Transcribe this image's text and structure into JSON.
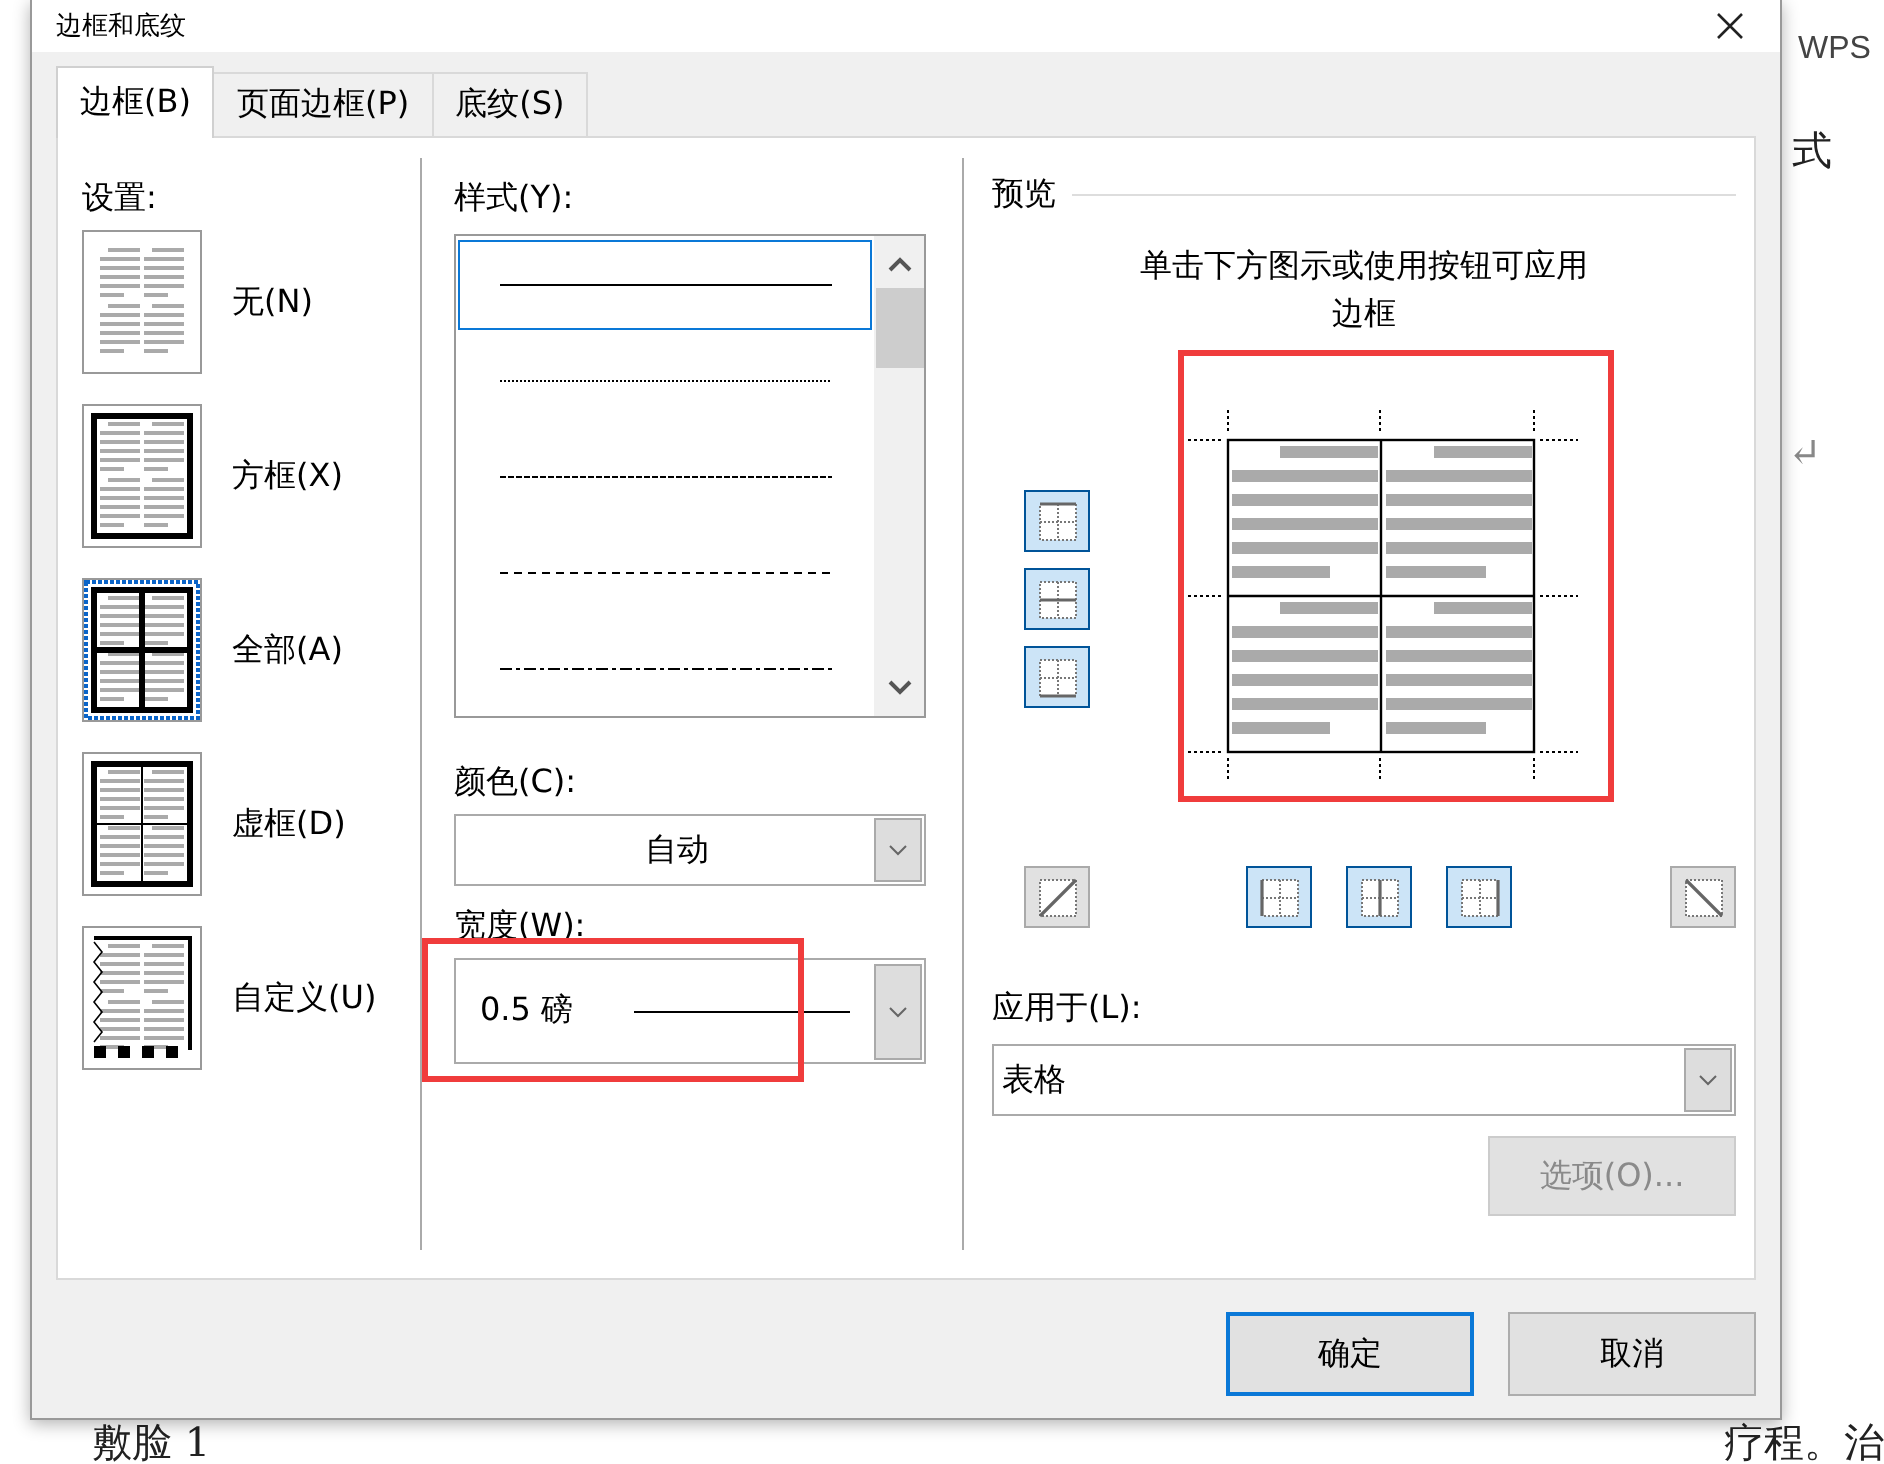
{
  "document": {
    "texts": [
      {
        "kind": "top-right",
        "text": "WPS"
      },
      {
        "kind": "right",
        "text": "式"
      },
      {
        "kind": "mark",
        "text": "↵"
      },
      {
        "kind": "bottom-left",
        "text": "敷脸 1"
      },
      {
        "kind": "bottom-right",
        "text": "疗程。治"
      }
    ]
  },
  "window": {
    "title": "边框和底纹"
  },
  "tabs": [
    {
      "label": "边框(B)",
      "selected": true
    },
    {
      "label": "页面边框(P)",
      "selected": false
    },
    {
      "label": "底纹(S)",
      "selected": false
    }
  ],
  "settings": {
    "label": "设置:",
    "items": [
      {
        "kind": "none",
        "label": "无(N)",
        "selected": false
      },
      {
        "kind": "box",
        "label": "方框(X)",
        "selected": false
      },
      {
        "kind": "all",
        "label": "全部(A)",
        "selected": true
      },
      {
        "kind": "grid",
        "label": "虚框(D)",
        "selected": false
      },
      {
        "kind": "custom",
        "label": "自定义(U)",
        "selected": false
      }
    ]
  },
  "style": {
    "label": "样式(Y):",
    "items": [
      {
        "kind": "solid",
        "selected": true
      },
      {
        "kind": "dotted",
        "selected": false
      },
      {
        "kind": "fine-dash",
        "selected": false
      },
      {
        "kind": "dash",
        "selected": false
      },
      {
        "kind": "dash-dot",
        "selected": false
      }
    ]
  },
  "color": {
    "label": "颜色(C):",
    "value": "自动"
  },
  "width": {
    "label": "宽度(W):",
    "value": "0.5 磅",
    "highlighted": true
  },
  "preview": {
    "label": "预览",
    "hint": "单击下方图示或使用按钮可应用边框",
    "highlighted": true,
    "side_buttons": [
      {
        "kind": "top",
        "on": true
      },
      {
        "kind": "middle",
        "on": true
      },
      {
        "kind": "bottom",
        "on": true
      }
    ],
    "bottom_buttons": [
      {
        "kind": "diag-up",
        "on": false
      },
      {
        "kind": "left",
        "on": true
      },
      {
        "kind": "center",
        "on": true
      },
      {
        "kind": "right",
        "on": true
      },
      {
        "kind": "diag-down",
        "on": false
      }
    ]
  },
  "apply_to": {
    "label": "应用于(L):",
    "value": "表格"
  },
  "options_button": {
    "label": "选项(O)...",
    "disabled": true
  },
  "buttons": [
    {
      "label": "确定",
      "default": true
    },
    {
      "label": "取消",
      "default": false
    }
  ]
}
